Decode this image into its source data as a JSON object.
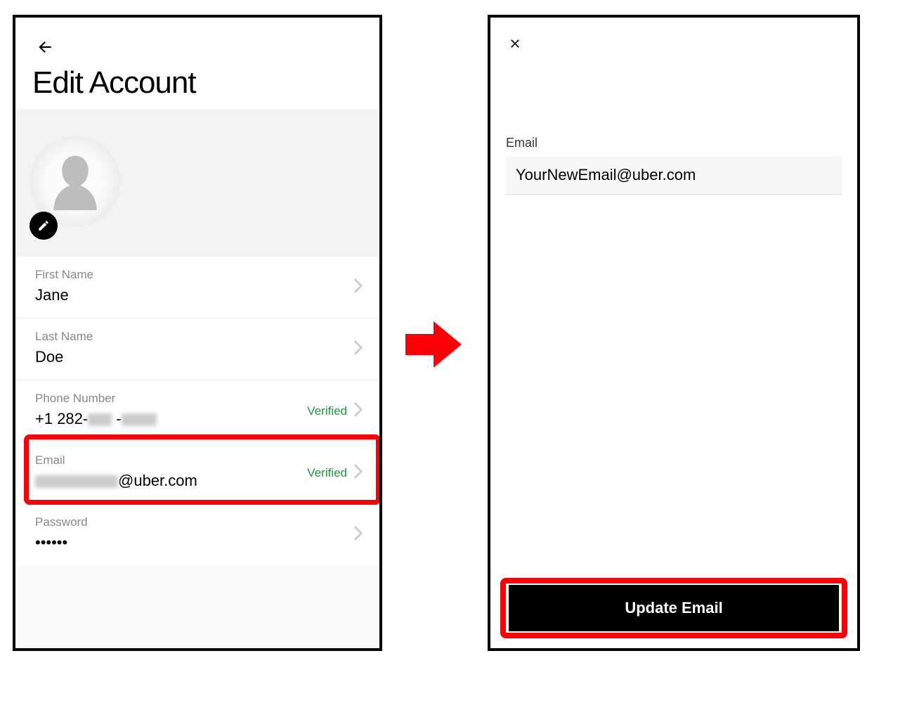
{
  "left": {
    "title": "Edit Account",
    "fields": {
      "first_name": {
        "label": "First Name",
        "value": "Jane"
      },
      "last_name": {
        "label": "Last Name",
        "value": "Doe"
      },
      "phone": {
        "label": "Phone Number",
        "prefix": "+1 282-",
        "verified": "Verified"
      },
      "email": {
        "label": "Email",
        "suffix": "@uber.com",
        "verified": "Verified"
      },
      "password": {
        "label": "Password",
        "value": "••••••"
      }
    }
  },
  "right": {
    "email_label": "Email",
    "email_value": "YourNewEmail@uber.com",
    "update_button": "Update Email"
  },
  "colors": {
    "highlight": "#fb0007",
    "verified": "#1a9c3c"
  }
}
